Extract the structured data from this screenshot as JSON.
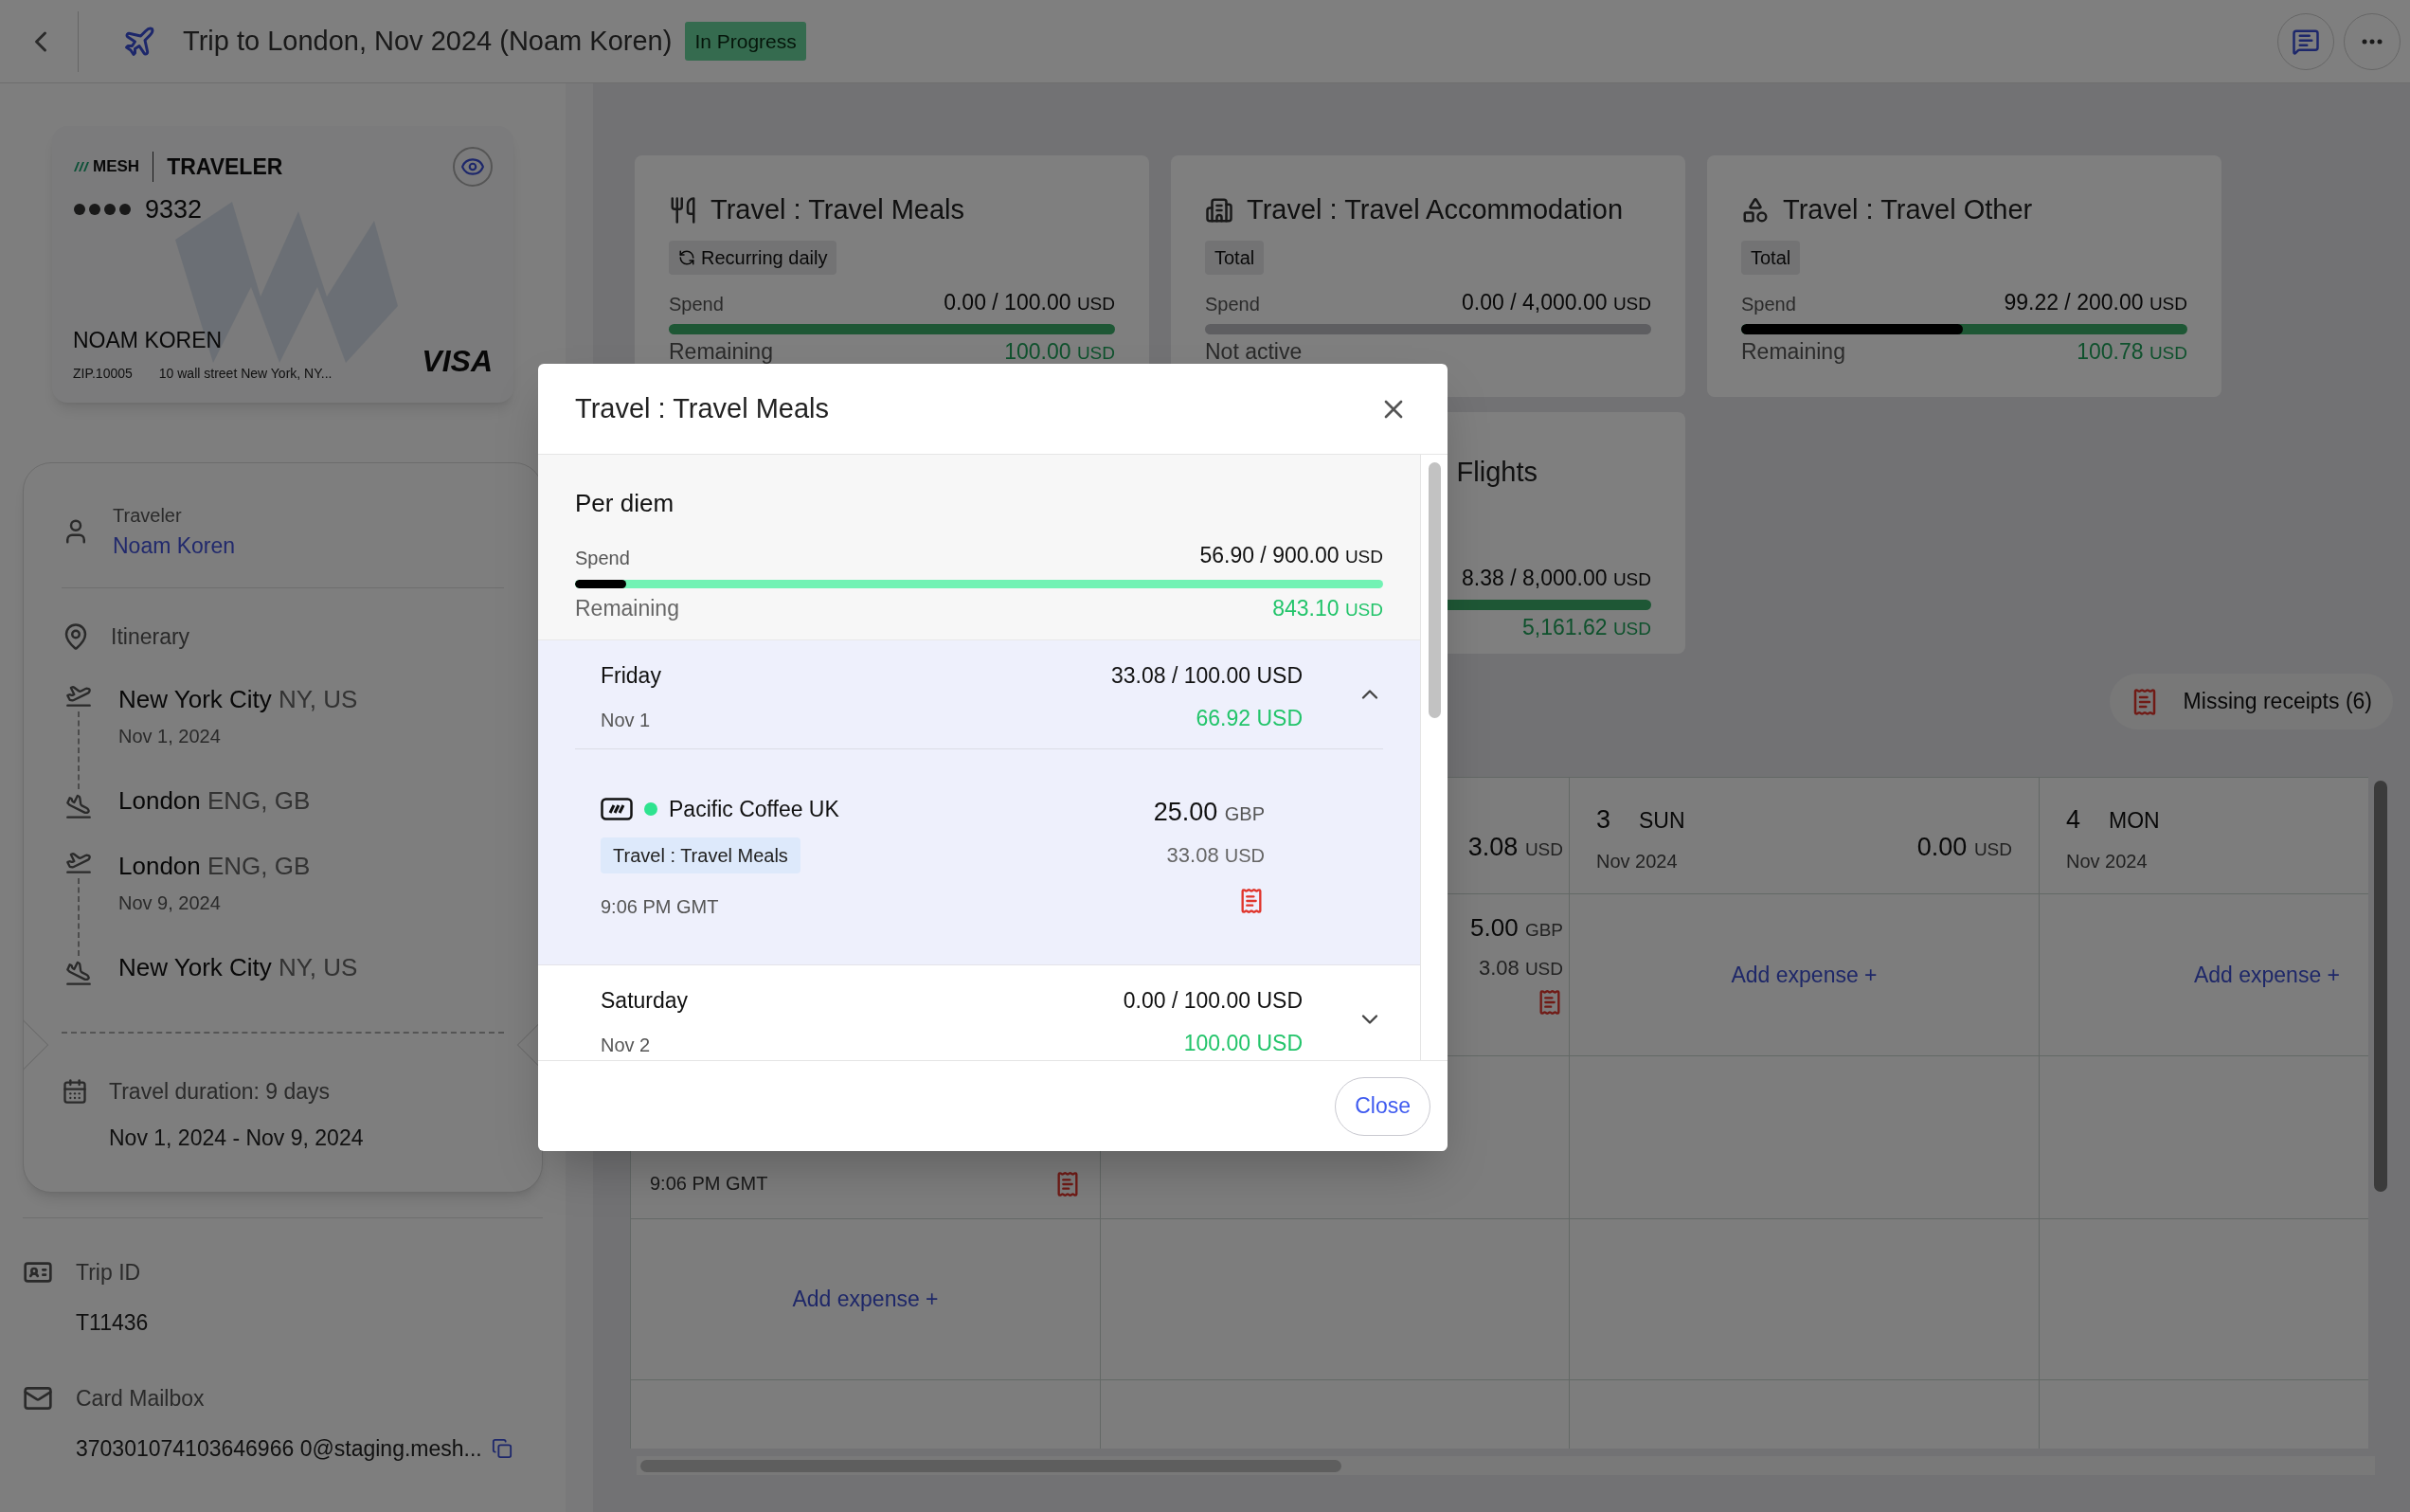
{
  "header": {
    "title": "Trip to London, Nov 2024 (Noam Koren)",
    "status": "In Progress"
  },
  "card": {
    "brand": "MESH",
    "label": "TRAVELER",
    "last4": "9332",
    "holder": "NOAM KOREN",
    "zip": "ZIP.10005",
    "address": "10 wall street New York, NY...",
    "network": "VISA"
  },
  "traveler": {
    "label": "Traveler",
    "name": "Noam Koren"
  },
  "itinerary": {
    "label": "Itinerary",
    "legs": [
      {
        "from": {
          "city": "New York City",
          "region": "NY, US",
          "date": "Nov 1, 2024"
        },
        "to": {
          "city": "London",
          "region": "ENG, GB"
        }
      },
      {
        "from": {
          "city": "London",
          "region": "ENG, GB",
          "date": "Nov 9, 2024"
        },
        "to": {
          "city": "New York City",
          "region": "NY, US"
        }
      }
    ]
  },
  "duration": {
    "label": "Travel duration: 9 days",
    "range": "Nov 1, 2024 - Nov 9, 2024"
  },
  "trip_id": {
    "label": "Trip ID",
    "value": "T11436"
  },
  "mailbox": {
    "label": "Card Mailbox",
    "value": "370301074103646966 0@staging.mesh..."
  },
  "budgets": [
    {
      "kind": "meals",
      "title": "Travel : Travel Meals",
      "tag": "Recurring daily",
      "recurring": true,
      "spend_label": "Spend",
      "spend": "0.00 / 100.00",
      "currency": "USD",
      "active": true,
      "status_label": "Remaining",
      "remaining": "100.00",
      "remaining_currency": "USD"
    },
    {
      "kind": "accommodation",
      "title": "Travel : Travel Accommodation",
      "tag": "Total",
      "recurring": false,
      "spend_label": "Spend",
      "spend": "0.00 / 4,000.00",
      "currency": "USD",
      "active": false,
      "status_label": "Not active"
    },
    {
      "kind": "other",
      "title": "Travel : Travel Other",
      "tag": "Total",
      "recurring": false,
      "spend_label": "Spend",
      "spend": "99.22 / 200.00",
      "currency": "USD",
      "level": 0.496,
      "active": true,
      "status_label": "Remaining",
      "remaining": "100.78",
      "remaining_currency": "USD"
    },
    {
      "kind": "flights",
      "title": "Flights",
      "spend": "8.38 / 8,000.00",
      "currency": "USD",
      "active": true,
      "remaining": "5,161.62",
      "remaining_currency": "USD"
    }
  ],
  "missing_receipts": {
    "label": "Missing receipts (6)"
  },
  "calendar": {
    "days": [
      {
        "expense_time": "9:06 PM GMT",
        "missing_receipt": true,
        "add_label": "Add expense +"
      },
      {
        "total": "3.08",
        "total_currency": "USD",
        "expense_amount": "5.00",
        "expense_currency": "GBP",
        "expense_converted": "3.08",
        "converted_currency": "USD",
        "missing_receipt": true
      },
      {
        "day": "3",
        "weekday": "SUN",
        "month": "Nov 2024",
        "total": "0.00",
        "total_currency": "USD",
        "add_label": "Add expense +"
      },
      {
        "day": "4",
        "weekday": "MON",
        "month": "Nov 2024",
        "add_label": "Add expense +"
      }
    ]
  },
  "modal": {
    "title": "Travel : Travel Meals",
    "per_diem": {
      "title": "Per diem",
      "spend_label": "Spend",
      "spend": "56.90 / 900.00",
      "currency": "USD",
      "level": 0.063,
      "remaining_label": "Remaining",
      "remaining": "843.10",
      "remaining_currency": "USD"
    },
    "days": [
      {
        "weekday": "Friday",
        "date": "Nov 1",
        "spend": "33.08 / 100.00 USD",
        "remaining": "66.92 USD",
        "expanded": true,
        "expenses": [
          {
            "merchant": "Pacific Coffee UK",
            "color": "#2ee38f",
            "category": "Travel : Travel Meals",
            "time": "9:06 PM GMT",
            "amount": "25.00",
            "currency": "GBP",
            "converted": "33.08",
            "converted_currency": "USD",
            "missing_receipt": true
          }
        ]
      },
      {
        "weekday": "Saturday",
        "date": "Nov 2",
        "spend": "0.00 / 100.00 USD",
        "remaining": "100.00 USD",
        "expanded": false
      }
    ],
    "close_label": "Close"
  }
}
